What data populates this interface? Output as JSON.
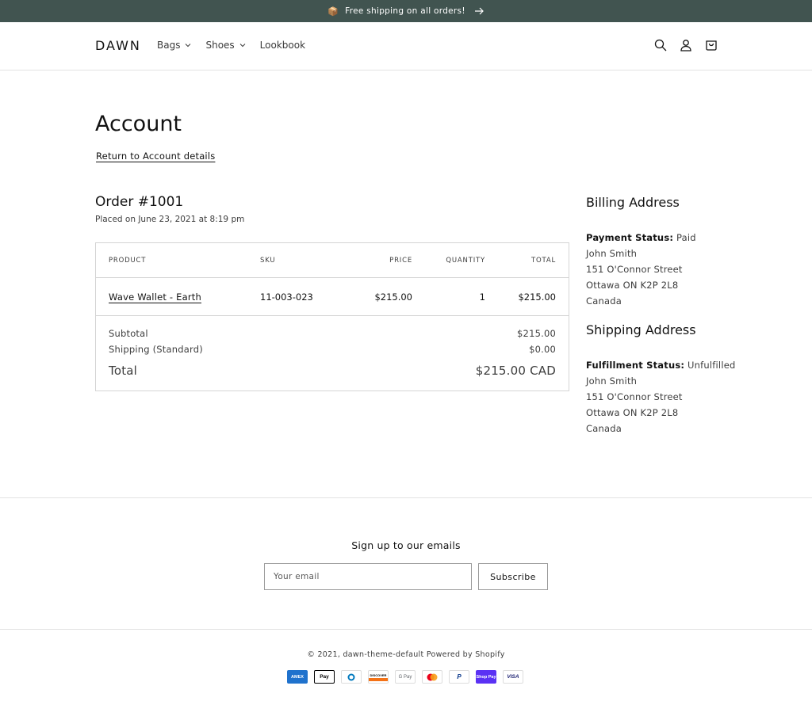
{
  "announcement": {
    "emoji": "📦",
    "text": "Free shipping on all orders!"
  },
  "header": {
    "logo": "DAWN",
    "nav": [
      {
        "label": "Bags",
        "dropdown": true
      },
      {
        "label": "Shoes",
        "dropdown": true
      },
      {
        "label": "Lookbook",
        "dropdown": false
      }
    ],
    "icons": [
      "search-icon",
      "account-icon",
      "cart-icon"
    ]
  },
  "page": {
    "title": "Account",
    "return_link": "Return to Account details"
  },
  "order": {
    "title": "Order #1001",
    "placed": "Placed on June 23, 2021 at 8:19 pm",
    "columns": [
      "PRODUCT",
      "SKU",
      "PRICE",
      "QUANTITY",
      "TOTAL"
    ],
    "items": [
      {
        "product": "Wave Wallet - Earth",
        "sku": "11-003-023",
        "price": "$215.00",
        "quantity": "1",
        "total": "$215.00"
      }
    ],
    "subtotal_label": "Subtotal",
    "subtotal_value": "$215.00",
    "shipping_label": "Shipping (Standard)",
    "shipping_value": "$0.00",
    "total_label": "Total",
    "total_value": "$215.00 CAD"
  },
  "billing": {
    "heading": "Billing Address",
    "status_label": "Payment Status:",
    "status_value": "Paid",
    "name": "John Smith",
    "street": "151 O'Connor Street",
    "city": "Ottawa ON K2P 2L8",
    "country": "Canada"
  },
  "shipping": {
    "heading": "Shipping Address",
    "status_label": "Fulfillment Status:",
    "status_value": "Unfulfilled",
    "name": "John Smith",
    "street": "151 O'Connor Street",
    "city": "Ottawa ON K2P 2L8",
    "country": "Canada"
  },
  "newsletter": {
    "title": "Sign up to our emails",
    "placeholder": "Your email",
    "button": "Subscribe"
  },
  "footer": {
    "copyright": "© 2021, dawn-theme-default Powered by Shopify",
    "payments": [
      {
        "name": "amex-icon",
        "label": "AMEX",
        "bg": "#1f72cd",
        "fg": "#ffffff"
      },
      {
        "name": "apple-pay-icon",
        "label": " Pay",
        "bg": "#ffffff",
        "fg": "#000000"
      },
      {
        "name": "diners-club-icon",
        "label": "D",
        "bg": "#ffffff",
        "fg": "#0079be"
      },
      {
        "name": "discover-icon",
        "label": "DISCOVER",
        "bg": "#ffffff",
        "fg": "#000000"
      },
      {
        "name": "google-pay-icon",
        "label": "G Pay",
        "bg": "#ffffff",
        "fg": "#5f6368"
      },
      {
        "name": "mastercard-icon",
        "label": "",
        "bg": "#ffffff",
        "fg": "#000000"
      },
      {
        "name": "paypal-icon",
        "label": "P",
        "bg": "#ffffff",
        "fg": "#003087"
      },
      {
        "name": "shop-pay-icon",
        "label": "Shop Pay",
        "bg": "#5a31f4",
        "fg": "#ffffff"
      },
      {
        "name": "visa-icon",
        "label": "VISA",
        "bg": "#ffffff",
        "fg": "#1a1f71"
      }
    ]
  },
  "colors": {
    "announcement_bg": "#415450",
    "text": "#121212",
    "muted": "#3d3d3d",
    "border": "#d4d4d4"
  }
}
